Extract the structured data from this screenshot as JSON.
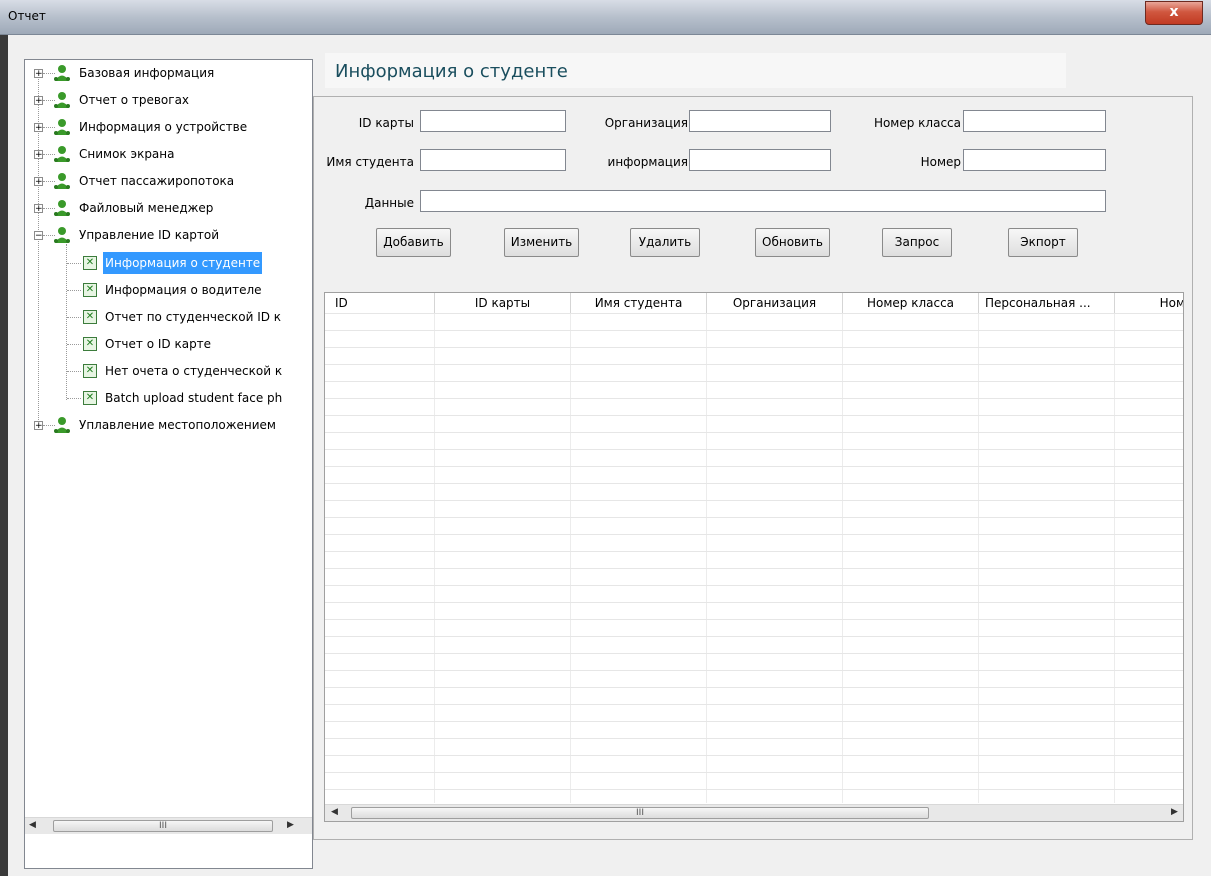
{
  "window": {
    "title": "Отчет",
    "close_label": "x"
  },
  "tree": {
    "items": [
      {
        "label": "Базовая информация",
        "expander": "+"
      },
      {
        "label": "Отчет о тревогах",
        "expander": "+"
      },
      {
        "label": "Информация о устройстве",
        "expander": "+"
      },
      {
        "label": "Снимок экрана",
        "expander": "+"
      },
      {
        "label": "Отчет пассажиропотока",
        "expander": "+"
      },
      {
        "label": "Файловый менеджер",
        "expander": "+"
      },
      {
        "label": "Управление ID картой",
        "expander": "−"
      },
      {
        "label": "Уплавление местоположением",
        "expander": "+"
      }
    ],
    "children": [
      {
        "label": "Информация о студенте"
      },
      {
        "label": "Информация о водителе"
      },
      {
        "label": "Отчет по студенческой ID к"
      },
      {
        "label": "Отчет о ID карте"
      },
      {
        "label": "Нет очета о студенческой к"
      },
      {
        "label": "Batch upload student face ph"
      }
    ],
    "scroll_thumb": "III"
  },
  "heading": "Информация о студенте",
  "form": {
    "card_id": {
      "label": "ID карты",
      "value": ""
    },
    "organization": {
      "label": "Организация",
      "value": ""
    },
    "class_number": {
      "label": "Номер класса",
      "value": ""
    },
    "student_name": {
      "label": "Имя студента",
      "value": ""
    },
    "info": {
      "label": "информация",
      "value": ""
    },
    "number": {
      "label": "Номер",
      "value": ""
    },
    "data": {
      "label": "Данные",
      "value": ""
    }
  },
  "buttons": {
    "add": "Добавить",
    "edit": "Изменить",
    "delete": "Удалить",
    "refresh": "Обновить",
    "query": "Запрос",
    "export": "Экпорт"
  },
  "table": {
    "columns": [
      "ID",
      "ID карты",
      "Имя студента",
      "Организация",
      "Номер класса",
      "Персональная ...",
      "Ном"
    ],
    "rows": [],
    "scroll_thumb": "III"
  }
}
